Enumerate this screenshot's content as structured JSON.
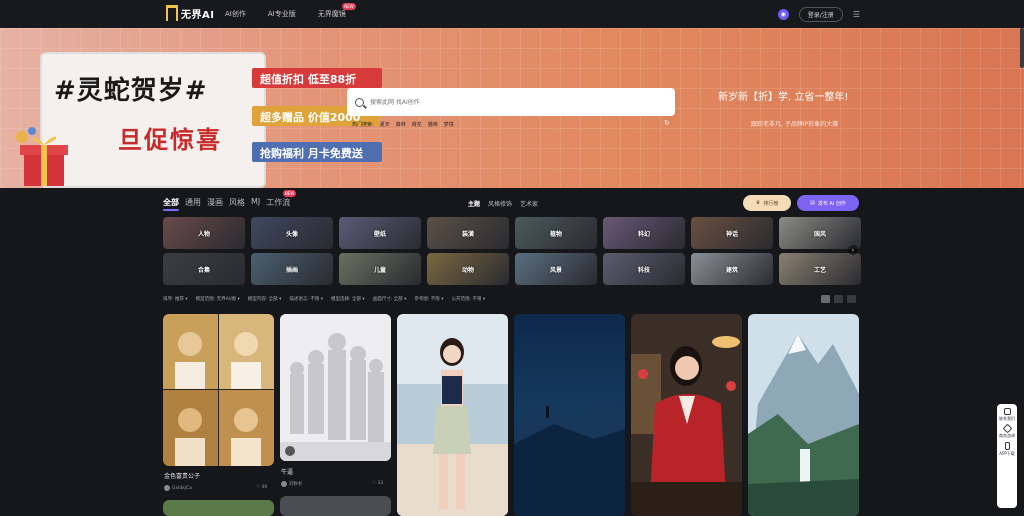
{
  "header": {
    "logo_text": "无界AI",
    "nav": [
      {
        "label": "AI创作",
        "badge": ""
      },
      {
        "label": "AI专业版",
        "badge": ""
      },
      {
        "label": "无界魔镜",
        "badge": "NEW"
      }
    ],
    "login_label": "登录/注册"
  },
  "banner": {
    "promo_title": "#灵蛇贺岁#",
    "promo_sub": "旦促惊喜",
    "tags": [
      "超值折扣  低至88折",
      "超多赠品  价值2000",
      "抢购福利  月卡免费送"
    ],
    "search_placeholder": "搜索此网 找AI创作",
    "hot_label": "热门搜索:",
    "hot_terms": [
      "夏天",
      "森林",
      "荷花",
      "猫咪",
      "梦境"
    ],
    "right_headline": "新岁新【折】学, 立省一整年!",
    "right_sub": "跟踪老非凡, 子品牌IP形象的大赛"
  },
  "category_tabs": [
    {
      "label": "全部",
      "active": true,
      "badge": ""
    },
    {
      "label": "通用",
      "active": false,
      "badge": ""
    },
    {
      "label": "漫画",
      "active": false,
      "badge": ""
    },
    {
      "label": "风格",
      "active": false,
      "badge": ""
    },
    {
      "label": "MJ",
      "active": false,
      "badge": ""
    },
    {
      "label": "工作流",
      "active": false,
      "badge": "NEW"
    }
  ],
  "sub_tabs": [
    {
      "label": "主题",
      "active": true
    },
    {
      "label": "风格修饰",
      "active": false
    },
    {
      "label": "艺术家",
      "active": false
    }
  ],
  "rank_label": "排行榜",
  "create_label": "发布 AI 创作",
  "styles": [
    {
      "label": "人物",
      "color": "#6a4a4a"
    },
    {
      "label": "头像",
      "color": "#3e4860"
    },
    {
      "label": "壁纸",
      "color": "#5a5c78"
    },
    {
      "label": "装潢",
      "color": "#5c5046"
    },
    {
      "label": "植物",
      "color": "#4a5a5e"
    },
    {
      "label": "科幻",
      "color": "#6a5878"
    },
    {
      "label": "神话",
      "color": "#6a5040"
    },
    {
      "label": "国风",
      "color": "#8a8a84"
    },
    {
      "label": "合集",
      "color": "#3a3e44"
    },
    {
      "label": "插画",
      "color": "#4a6070"
    },
    {
      "label": "儿童",
      "color": "#6a7060"
    },
    {
      "label": "动物",
      "color": "#7a6840"
    },
    {
      "label": "风景",
      "color": "#5a6e80"
    },
    {
      "label": "科技",
      "color": "#5c5c70"
    },
    {
      "label": "建筑",
      "color": "#8a9098"
    },
    {
      "label": "工艺",
      "color": "#8a8070"
    }
  ],
  "filters": [
    "排序: 推荐",
    "模型范围: 无界AI/图",
    "模型内容: 全部",
    "描述语言: 不限",
    "模型选择: 全部",
    "画面尺寸: 全部",
    "参考图: 不限",
    "公开范围: 不限"
  ],
  "cards": [
    {
      "title": "金色富贵公子",
      "author": "GxldkjCa",
      "likes": "49"
    },
    {
      "title": "牛逼",
      "author": "刘秋杉",
      "likes": "33"
    }
  ],
  "side_float": [
    "联系我们",
    "商务咨询",
    "APP下载"
  ],
  "colors": {
    "accent": "#7c63f2",
    "bg": "#16171b"
  }
}
